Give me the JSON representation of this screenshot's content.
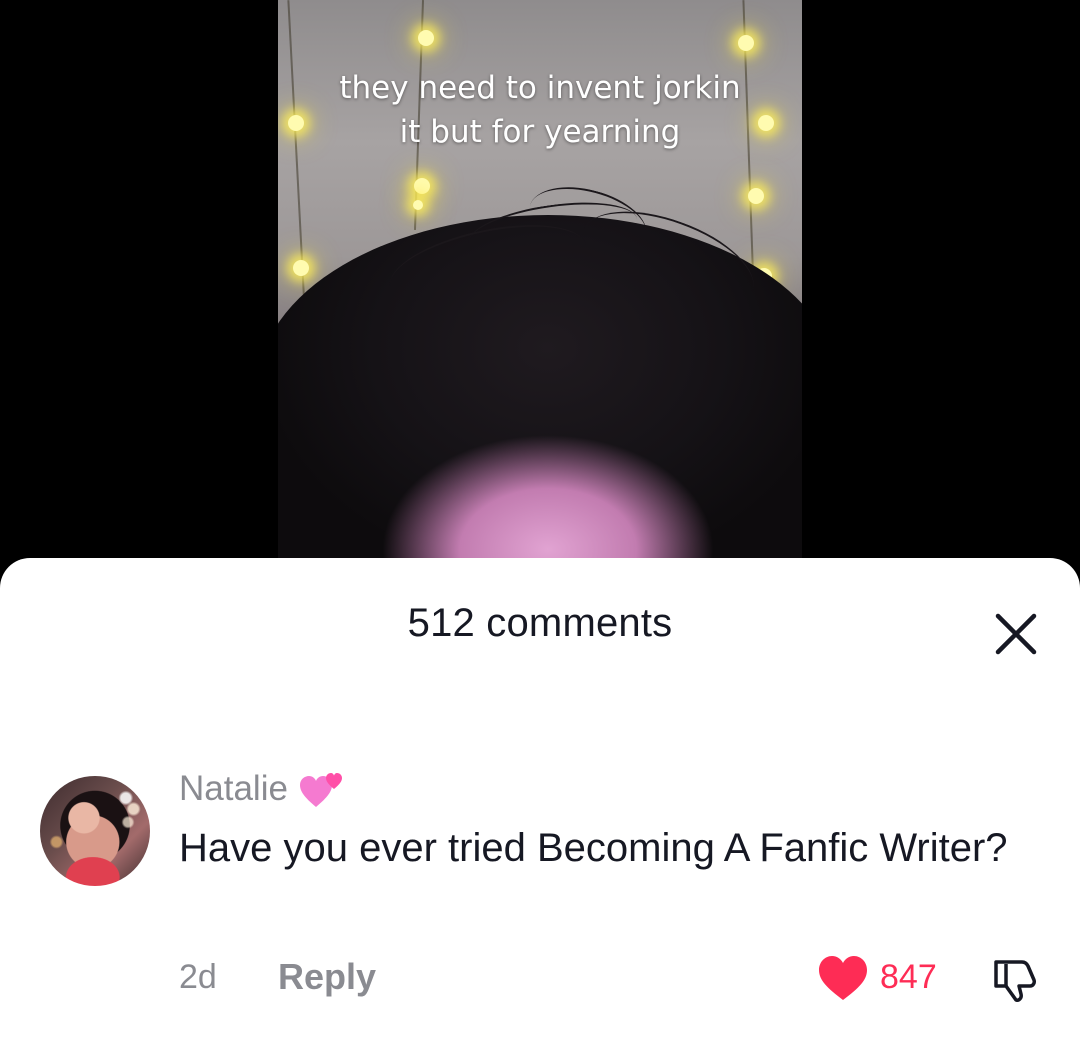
{
  "video": {
    "caption_line1": "they need to invent jorkin",
    "caption_line2": "it but for yearning"
  },
  "comments_sheet": {
    "title": "512 comments",
    "close_icon": "close-icon"
  },
  "comment": {
    "username": "Natalie",
    "username_emoji": "two-hearts-icon",
    "text": "Have you ever tried Becoming A Fanfic Writer?",
    "date": "2d",
    "reply_label": "Reply",
    "like_count": "847",
    "liked": true,
    "like_icon": "heart-icon",
    "dislike_icon": "thumbs-down-icon"
  },
  "colors": {
    "like_red": "#fe2c55",
    "muted_text": "#8a8b91",
    "primary_text": "#161823"
  }
}
